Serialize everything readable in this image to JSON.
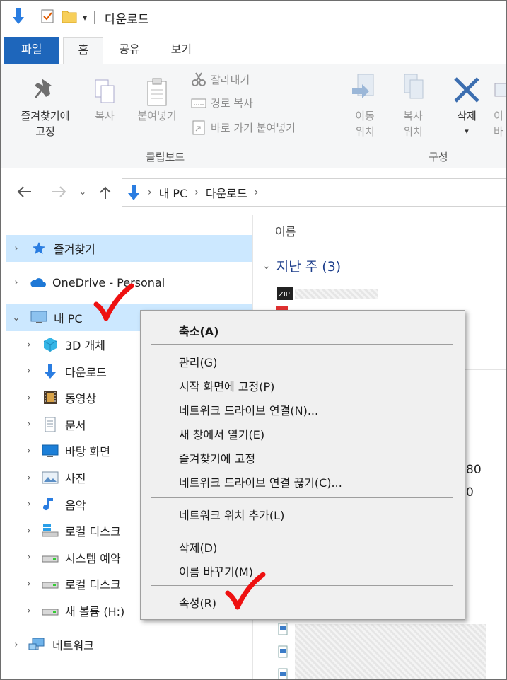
{
  "title_bar": {
    "title": "다운로드"
  },
  "ribbon": {
    "tabs": [
      "파일",
      "홈",
      "공유",
      "보기"
    ],
    "pin_quick_access": "즐겨찾기에\n고정",
    "copy": "복사",
    "paste": "붙여넣기",
    "cut": "잘라내기",
    "copy_path": "경로 복사",
    "paste_shortcut": "바로 가기 붙여넣기",
    "clipboard_group": "클립보드",
    "move_to": "이동\n위치",
    "copy_to": "복사\n위치",
    "delete": "삭제",
    "rename_partial": "이\n바",
    "organize_group": "구성"
  },
  "address": {
    "path": [
      "내 PC",
      "다운로드"
    ]
  },
  "nav_tree": [
    {
      "label": "즐겨찾기",
      "icon": "star-icon",
      "level": 0,
      "selected": true
    },
    {
      "label": "OneDrive - Personal",
      "icon": "cloud-icon",
      "level": 0,
      "selected": false
    },
    {
      "label": "내 PC",
      "icon": "monitor-icon",
      "level": 0,
      "selected": true,
      "expanded": true
    },
    {
      "label": "3D 개체",
      "icon": "cube-icon",
      "level": 1
    },
    {
      "label": "다운로드",
      "icon": "download-icon",
      "level": 1
    },
    {
      "label": "동영상",
      "icon": "film-icon",
      "level": 1
    },
    {
      "label": "문서",
      "icon": "document-icon",
      "level": 1
    },
    {
      "label": "바탕 화면",
      "icon": "desktop-icon",
      "level": 1
    },
    {
      "label": "사진",
      "icon": "picture-icon",
      "level": 1
    },
    {
      "label": "음악",
      "icon": "music-icon",
      "level": 1
    },
    {
      "label": "로컬 디스크",
      "icon": "windows-drive-icon",
      "level": 1
    },
    {
      "label": "시스템 예약",
      "icon": "drive-icon",
      "level": 1
    },
    {
      "label": "로컬 디스크",
      "icon": "drive-icon",
      "level": 1
    },
    {
      "label": "새 볼륨 (H:)",
      "icon": "drive-icon",
      "level": 1
    },
    {
      "label": "네트워크",
      "icon": "network-icon",
      "level": 0
    }
  ],
  "main": {
    "column_name": "이름",
    "group_header": "지난 주 (3)",
    "partial_80": "80",
    "partial_0": "0"
  },
  "context_menu": {
    "items": [
      {
        "label": "축소(A)",
        "bold": true
      },
      {
        "label": "관리(G)"
      },
      {
        "label": "시작 화면에 고정(P)"
      },
      {
        "label": "네트워크 드라이브 연결(N)..."
      },
      {
        "label": "새 창에서 열기(E)"
      },
      {
        "label": "즐겨찾기에 고정"
      },
      {
        "label": "네트워크 드라이브 연결 끊기(C)..."
      },
      {
        "label": "네트워크 위치 추가(L)"
      },
      {
        "label": "삭제(D)"
      },
      {
        "label": "이름 바꾸기(M)"
      },
      {
        "label": "속성(R)"
      }
    ]
  },
  "colors": {
    "file_tab": "#1e66bb",
    "selection": "#cce8ff",
    "check_mark": "#ee1111"
  }
}
